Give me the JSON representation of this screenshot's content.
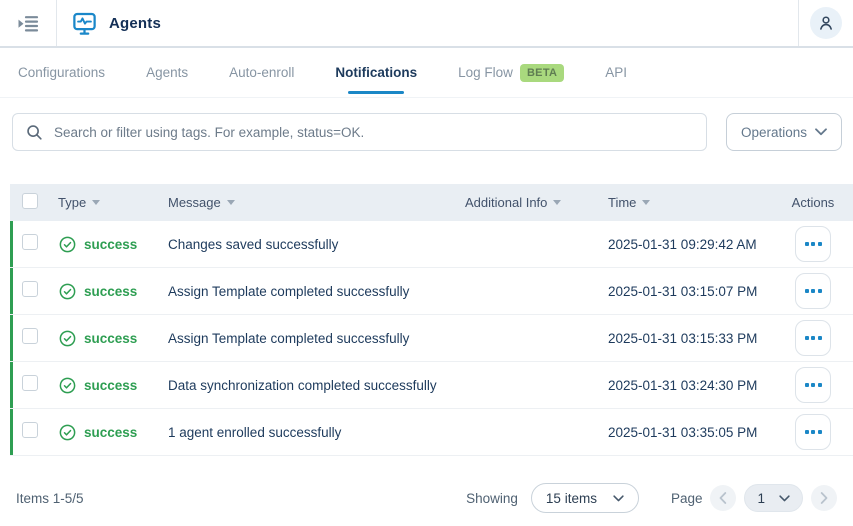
{
  "colors": {
    "accent_blue": "#1b87c6",
    "success_green": "#2e9e52",
    "badge_bg": "#a9d97e",
    "header_bg": "#e9eef3"
  },
  "header": {
    "title": "Agents"
  },
  "tabs": [
    {
      "label": "Configurations"
    },
    {
      "label": "Agents"
    },
    {
      "label": "Auto-enroll"
    },
    {
      "label": "Notifications",
      "active": true
    },
    {
      "label": "Log Flow",
      "badge": "BETA"
    },
    {
      "label": "API"
    }
  ],
  "toolbar": {
    "search_placeholder": "Search or filter using tags. For example, status=OK.",
    "operations_label": "Operations"
  },
  "table": {
    "columns": {
      "type": "Type",
      "message": "Message",
      "additional_info": "Additional Info",
      "time": "Time",
      "actions": "Actions"
    },
    "rows": [
      {
        "type": "success",
        "message": "Changes saved successfully",
        "time": "2025-01-31 09:29:42 AM"
      },
      {
        "type": "success",
        "message": "Assign Template completed successfully",
        "time": "2025-01-31 03:15:07 PM"
      },
      {
        "type": "success",
        "message": "Assign Template completed successfully",
        "time": "2025-01-31 03:15:33 PM"
      },
      {
        "type": "success",
        "message": "Data synchronization completed successfully",
        "time": "2025-01-31 03:24:30 PM"
      },
      {
        "type": "success",
        "message": "1 agent enrolled successfully",
        "time": "2025-01-31 03:35:05 PM"
      }
    ]
  },
  "footer": {
    "items_label": "Items 1-5/5",
    "showing_label": "Showing",
    "page_size": "15 items",
    "page_label": "Page",
    "current_page": "1"
  }
}
